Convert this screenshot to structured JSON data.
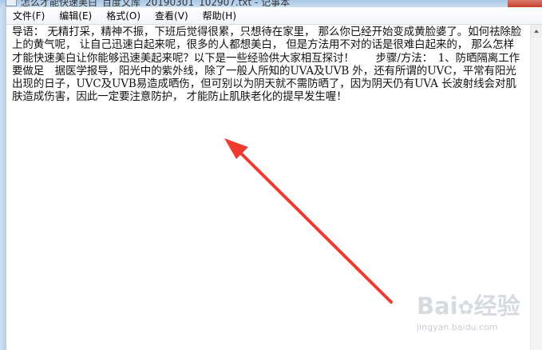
{
  "window": {
    "title": "怎么才能快速美白_百度文库_20190301_102907.txt - 记事本"
  },
  "menu": {
    "items": [
      {
        "label": "文件(F)"
      },
      {
        "label": "编辑(E)"
      },
      {
        "label": "格式(O)"
      },
      {
        "label": "查看(V)"
      },
      {
        "label": "帮助(H)"
      }
    ]
  },
  "document": {
    "text": "导语： 无精打采，精神不振，下班后觉得很累，只想待在家里， 那么你已经开始变成黄脸婆了。如何祛除脸上的黄气呢， 让自己迅速白起来呢，很多的人都想美白， 但是方法用不对的话是很难白起来的， 那么怎样才能快速美白让你能够迅速美起来呢？以下是一些经验供大家相互探讨！　　步骤/方法：　1、防晒隔离工作要做足　据医学报导，阳光中的紫外线，除了一般人所知的UVA及UVB 外，还有所谓的UVC，平常有阳光出现的日子，UVC及UVB易造成晒伤，但可别以为阴天就不需防晒了，因为阴天仍有UVA 长波射线会对肌肤造成伤害，因此一定要注意防护， 才能防止肌肤老化的提早发生喔！"
  },
  "annotation": {
    "arrow_color": "#ee3a2f"
  },
  "watermark": {
    "logo_left": "Bai",
    "logo_right": "经验",
    "logo_paw": "✿",
    "jingyan": "经验",
    "url": "jingyan.baidu.com"
  }
}
